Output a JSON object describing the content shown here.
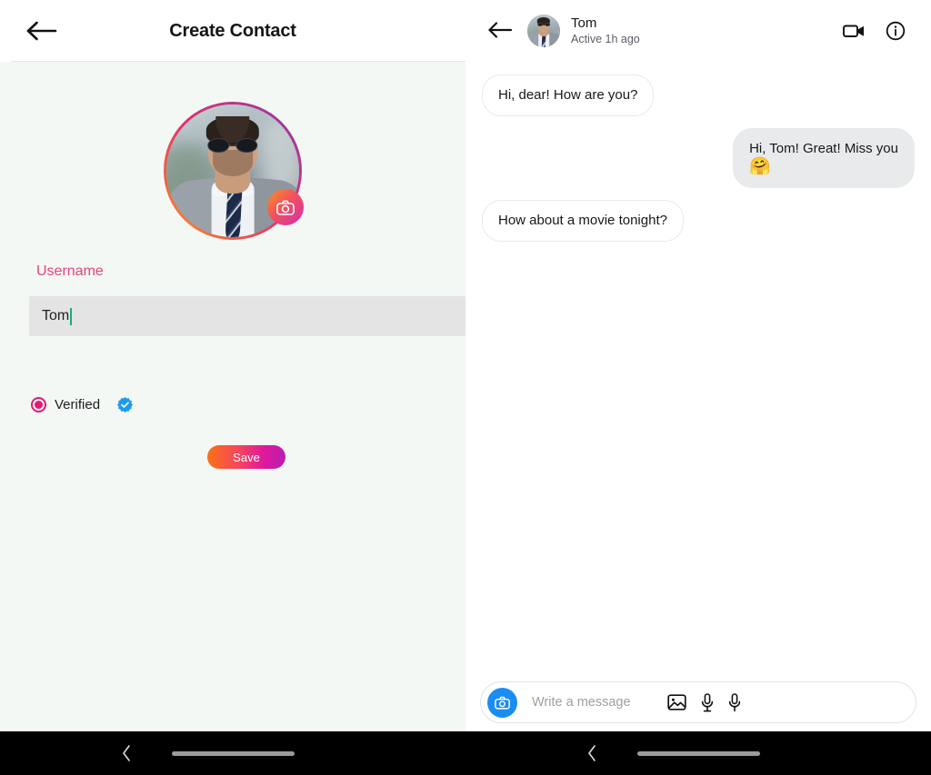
{
  "left_screen": {
    "header": {
      "title": "Create Contact",
      "back_icon": "arrow-left-icon"
    },
    "avatar": {
      "ring_gradient": [
        "#f9a826",
        "#e1306c",
        "#833ab4"
      ],
      "camera_badge_icon": "camera-icon",
      "camera_badge_gradient": [
        "#f7971e",
        "#d62bb0"
      ]
    },
    "form": {
      "username_label": "Username",
      "username_value": "Tom",
      "username_placeholder": "Username",
      "verified_label": "Verified",
      "verified_selected": true,
      "verified_badge_icon": "verified-check-badge-icon",
      "verified_badge_color": "#1d9bf0",
      "radio_color": "#e21b73",
      "label_color": "#e8417d",
      "save_label": "Save",
      "save_gradient": [
        "#f97316",
        "#e0189d",
        "#b81fb0"
      ]
    },
    "navbar": {
      "back_icon": "chevron-left-icon",
      "home_indicator": "home-pill-indicator"
    },
    "background_color": "#f4f8f5"
  },
  "right_screen": {
    "header": {
      "back_icon": "arrow-left-icon",
      "avatar": "contact-avatar",
      "name": "Tom",
      "status": "Active 1h ago",
      "video_call_icon": "video-camera-icon",
      "info_icon": "info-circle-icon"
    },
    "messages": [
      {
        "direction": "in",
        "text": "Hi, dear! How are you?",
        "emoji": ""
      },
      {
        "direction": "out",
        "text": "Hi, Tom! Great! Miss you",
        "emoji": "🤗"
      },
      {
        "direction": "in",
        "text": "How about a movie tonight?",
        "emoji": ""
      }
    ],
    "composer": {
      "camera_icon": "camera-icon",
      "camera_color": "#1b8df2",
      "placeholder": "Write a message",
      "gallery_icon": "image-icon",
      "audio_icon": "microphone-icon",
      "voice_icon": "microphone-icon"
    },
    "navbar": {
      "back_icon": "chevron-left-icon",
      "home_indicator": "home-pill-indicator"
    },
    "background_color": "#ffffff"
  }
}
